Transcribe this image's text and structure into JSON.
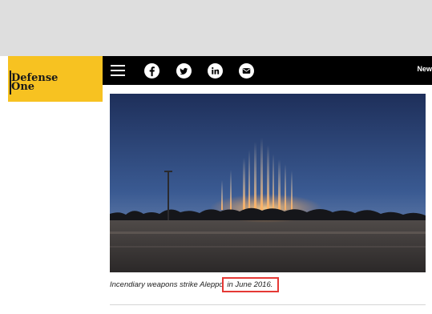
{
  "brand": {
    "logo_line1": "Defense",
    "logo_line2": "One",
    "logo_color": "#f7c221"
  },
  "nav": {
    "menu_icon": "hamburger-icon",
    "social_icons": [
      "facebook-icon",
      "twitter-icon",
      "linkedin-icon",
      "email-icon"
    ],
    "right_text": "New"
  },
  "article": {
    "image_subject": "night sky with burning incendiary munitions over a tree line",
    "caption_pre": "Incendiary weapons strike Aleppo",
    "caption_highlight": "in June 2016.",
    "highlight_color": "#e53935"
  }
}
